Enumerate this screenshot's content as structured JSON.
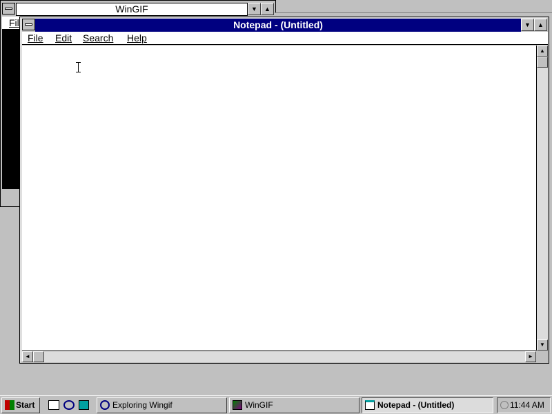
{
  "wingif_window": {
    "title": "WinGIF",
    "menu_partial": "Fil",
    "minimize_glyph": "▼",
    "maximize_glyph": "▲"
  },
  "notepad_window": {
    "title": "Notepad - (Untitled)",
    "minimize_glyph": "▼",
    "maximize_glyph": "▲",
    "menu": [
      {
        "label": "File"
      },
      {
        "label": "Edit"
      },
      {
        "label": "Search"
      },
      {
        "label": "Help"
      }
    ],
    "text_content": "",
    "scroll_up_glyph": "▲",
    "scroll_down_glyph": "▼",
    "scroll_left_glyph": "◄",
    "scroll_right_glyph": "►"
  },
  "taskbar": {
    "start_label": "Start",
    "quick_launch": [
      "printer-icon",
      "find-icon",
      "document-icon"
    ],
    "tasks": [
      {
        "label": "Exploring Wingif",
        "icon": "explorer-icon",
        "active": false
      },
      {
        "label": "WinGIF",
        "icon": "wingif-icon",
        "active": false
      },
      {
        "label": "Notepad - (Untitled)",
        "icon": "notepad-icon",
        "active": true
      }
    ],
    "clock": "11:44 AM"
  },
  "colors": {
    "desktop": "#c0c0c0",
    "title_active": "#000080",
    "title_inactive_bg": "#ffffff",
    "window_face": "#c0c0c0"
  }
}
